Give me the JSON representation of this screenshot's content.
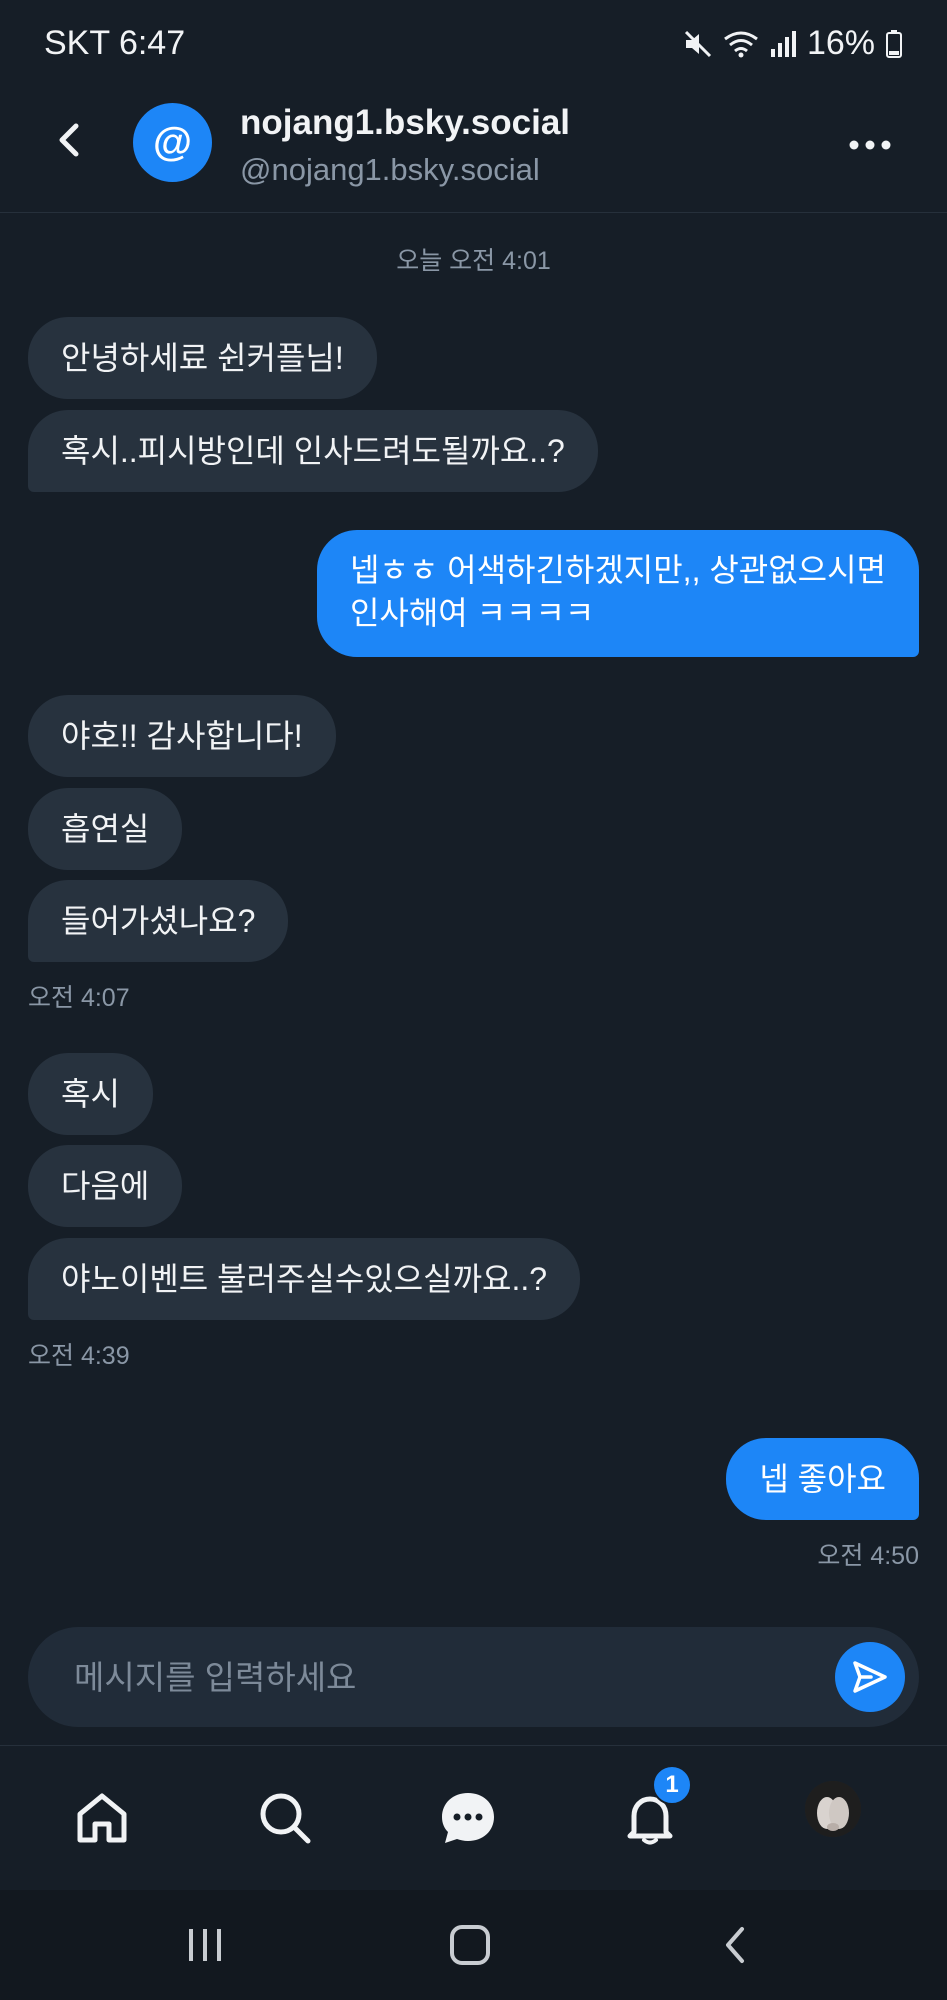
{
  "status_bar": {
    "carrier_time": "SKT 6:47",
    "battery": "16%"
  },
  "header": {
    "name": "nojang1.bsky.social",
    "handle": "@nojang1.bsky.social",
    "avatar_symbol": "@"
  },
  "chat": {
    "date_label": "오늘 오전 4:01",
    "messages": [
      {
        "dir": "in",
        "text": "안녕하세료 쉰커플님!"
      },
      {
        "dir": "in",
        "text": "혹시..피시방인데 인사드려도될까요..?"
      },
      {
        "dir": "out",
        "line1": "넵ㅎㅎ 어색하긴하겠지만,, 상관없으시면",
        "line2": "인사해여 ㅋㅋㅋㅋ"
      },
      {
        "dir": "in",
        "text": "야호!! 감사합니다!"
      },
      {
        "dir": "in",
        "text": "흡연실"
      },
      {
        "dir": "in",
        "text": "들어가셨나요?"
      },
      {
        "dir": "in",
        "text": "혹시"
      },
      {
        "dir": "in",
        "text": "다음에"
      },
      {
        "dir": "in",
        "text": "야노이벤트 불러주실수있으실까요..?"
      },
      {
        "dir": "out",
        "text": "넵 좋아요"
      }
    ],
    "timestamps": [
      "오전 4:07",
      "오전 4:39",
      "오전 4:50"
    ]
  },
  "composer": {
    "placeholder": "메시지를 입력하세요"
  },
  "bottom_nav": {
    "items": [
      "home-icon",
      "search-icon",
      "messages-icon",
      "notifications-icon",
      "profile-avatar"
    ],
    "notification_badge": "1"
  },
  "colors": {
    "background": "#161e27",
    "accent": "#1d86f7",
    "incoming_bubble": "#27323e"
  }
}
